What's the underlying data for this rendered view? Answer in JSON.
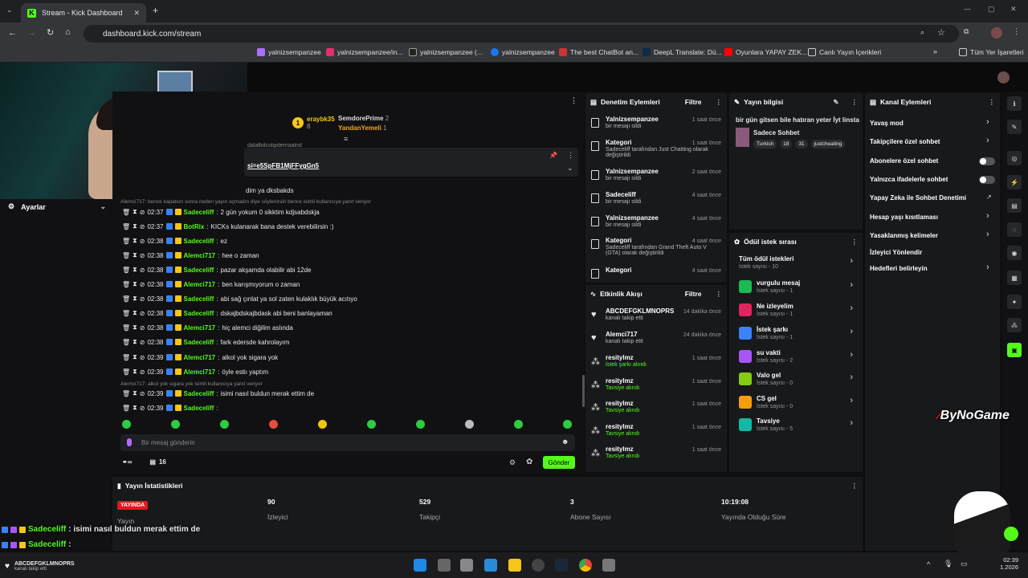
{
  "browser": {
    "tab_title": "Stream - Kick Dashboard",
    "url": "dashboard.kick.com/stream"
  },
  "bookmarks": [
    {
      "label": "yalnizsempanzee",
      "color": "#a970ff"
    },
    {
      "label": "yalnizsempanzee/in...",
      "color": "#e1306c"
    },
    {
      "label": "yalnizsempanzee (...",
      "color": "#111111"
    },
    {
      "label": "yalnizsempanzee",
      "color": "#1877f2"
    },
    {
      "label": "The best ChatBot an...",
      "color": "#cc3333"
    },
    {
      "label": "DeepL Translate: Dü...",
      "color": "#0f2b46"
    },
    {
      "label": "Oyunlara YAPAY ZEK...",
      "color": "#ff0000"
    },
    {
      "label": "Canlı Yayın İçerikleri",
      "color": "#555555"
    }
  ],
  "bookmarks_other": "Tüm Yer İşaretleri",
  "sidebar": {
    "settings_label": "Ayarlar"
  },
  "chat": {
    "pinned_top": [
      {
        "user": "eraybk35",
        "count": "8"
      },
      {
        "user": "SemdorePrime",
        "count": "2"
      },
      {
        "user": "YandanYemeli",
        "count": "1"
      }
    ],
    "pinned_text": "dalalbdcolgidemaalnd",
    "link_text": "si=e5SpFB1MjFFygGn5",
    "line_frag": "dim ya dksbakds",
    "reply_hint_1": "Alemci717: bence kapatsın sonra neden yayın açmadın diye söylenirsin bence isimli kullanıcıya yanıt veriyor",
    "reply_hint_2": "Alemci717: alkol yok sigara yok isimli kullanıcıya yanıt veriyor",
    "messages": [
      {
        "time": "02:37",
        "user": "Sadeceliff",
        "color": "#53fc18",
        "text": "2 gün yokum 0 sikktim kdjsabdskja"
      },
      {
        "time": "02:37",
        "user": "BotRix",
        "color": "#53fc18",
        "text": "KICKs kulanarak bana destek verebilirsin :)"
      },
      {
        "time": "02:38",
        "user": "Sadeceliff",
        "color": "#53fc18",
        "text": "ez"
      },
      {
        "time": "02:38",
        "user": "Alemci717",
        "color": "#53fc18",
        "text": "hee o zaman"
      },
      {
        "time": "02:38",
        "user": "Sadeceliff",
        "color": "#53fc18",
        "text": "pazar akşamda olabilir abi 12de"
      },
      {
        "time": "02:38",
        "user": "Alemci717",
        "color": "#53fc18",
        "text": "ben karışmıyorum o zaman"
      },
      {
        "time": "02:38",
        "user": "Sadeceliff",
        "color": "#53fc18",
        "text": "abi sağ çınlat ya sol zaten kulaklık büyük acıtıyo"
      },
      {
        "time": "02:38",
        "user": "Sadeceliff",
        "color": "#53fc18",
        "text": "dskajbdskajbdask abi beni banlayaman"
      },
      {
        "time": "02:38",
        "user": "Alemci717",
        "color": "#53fc18",
        "text": "hiç alemci diğilim aslında"
      },
      {
        "time": "02:38",
        "user": "Sadeceliff",
        "color": "#53fc18",
        "text": "fark edersde kahrolayım"
      },
      {
        "time": "02:39",
        "user": "Alemci717",
        "color": "#53fc18",
        "text": "alkol yok sigara yok"
      },
      {
        "time": "02:39",
        "user": "Alemci717",
        "color": "#53fc18",
        "text": "öyle estiı yaptım"
      },
      {
        "time": "02:39",
        "user": "Sadeceliff",
        "color": "#53fc18",
        "text": "isimi nasıl buldun merak ettim de"
      },
      {
        "time": "02:39",
        "user": "Sadeceliff",
        "color": "#53fc18",
        "text": ""
      }
    ],
    "input_placeholder": "Bir mesaj gönderin",
    "viewer_count": "16",
    "send_label": "Gönder"
  },
  "mod_actions": {
    "title": "Denetim Eylemleri",
    "filter": "Filtre",
    "items": [
      {
        "title": "Yalnizsempanzee",
        "sub": "bir mesajı sildi",
        "time": "1 saat önce"
      },
      {
        "title": "Kategori",
        "sub": "Sadeceliff tarafından Just Chatting olarak değiştirildi",
        "time": "1 saat önce"
      },
      {
        "title": "Yalnizsempanzee",
        "sub": "bir mesajı sildi",
        "time": "2 saat önce"
      },
      {
        "title": "Sadeceliff",
        "sub": "bir mesajı sildi",
        "time": "4 saat önce"
      },
      {
        "title": "Yalnizsempanzee",
        "sub": "bir mesajı sildi",
        "time": "4 saat önce"
      },
      {
        "title": "Kategori",
        "sub": "Sadeceliff tarafından Grand Theft Auto V (GTA) olarak değiştirildi",
        "time": "4 saat önce"
      },
      {
        "title": "Kategori",
        "sub": "",
        "time": "4 saat önce"
      }
    ]
  },
  "activity": {
    "title": "Etkinlik Akışı",
    "filter": "Filtre",
    "items": [
      {
        "title": "ABCDEFGKLMNOPRS",
        "sub": "kanalı takip etti",
        "time": "14 dakika önce"
      },
      {
        "title": "Alemci717",
        "sub": "kanalı takip etti",
        "time": "24 dakika önce"
      },
      {
        "title": "resitylmz",
        "sub": "İstek şarkı alındı",
        "time": "1 saat önce"
      },
      {
        "title": "resitylmz",
        "sub": "Tavsiye alındı",
        "time": "1 saat önce"
      },
      {
        "title": "resitylmz",
        "sub": "Tavsiye alındı",
        "time": "1 saat önce"
      },
      {
        "title": "resitylmz",
        "sub": "Tavsiye alındı",
        "time": "1 saat önce"
      },
      {
        "title": "resitylmz",
        "sub": "Tavsiye alındı",
        "time": "1 saat önce"
      }
    ]
  },
  "stream_info": {
    "title": "Yayın bilgisi",
    "stream_title": "bir gün gitsen bile hatıran yeter İyt linsta",
    "category": "Sadece Sohbet",
    "tags": [
      "Turkish",
      "18",
      "31",
      "justcheating"
    ]
  },
  "rewards": {
    "title": "Ödül istek sırası",
    "all_label": "Tüm ödül istekleri",
    "all_count": "İstek sayısı - 10",
    "items": [
      {
        "name": "vurgulu mesaj",
        "count": "İstek sayısı - 1",
        "color": "#1db954"
      },
      {
        "name": "Ne izleyelim",
        "count": "İstek sayısı - 1",
        "color": "#e0245e"
      },
      {
        "name": "İstek şarkı",
        "count": "İstek sayısı - 1",
        "color": "#3b82f6"
      },
      {
        "name": "su vakti",
        "count": "İstek sayısı - 2",
        "color": "#a855f7"
      },
      {
        "name": "Valo gel",
        "count": "İstek sayısı - 0",
        "color": "#84cc16"
      },
      {
        "name": "CS gel",
        "count": "İstek sayısı - 0",
        "color": "#f59e0b"
      },
      {
        "name": "Tavsiye",
        "count": "İstek sayısı - 5",
        "color": "#14b8a6"
      }
    ]
  },
  "channel_actions": {
    "title": "Kanal Eylemleri",
    "items": [
      {
        "label": "Yavaş mod",
        "kind": "arrow"
      },
      {
        "label": "Takipçilere özel sohbet",
        "kind": "arrow"
      },
      {
        "label": "Abonelere özel sohbet",
        "kind": "toggle"
      },
      {
        "label": "Yalnızca ifadelerle sohbet",
        "kind": "toggle"
      },
      {
        "label": "Yapay Zeka ile Sohbet Denetimi",
        "kind": "link"
      },
      {
        "label": "Hesap yaşı kısıtlaması",
        "kind": "arrow"
      },
      {
        "label": "Yasaklanmış kelimeler",
        "kind": "arrow"
      },
      {
        "label": "İzleyici Yönlendir",
        "kind": "none"
      },
      {
        "label": "Hedefleri belirleyin",
        "kind": "arrow"
      }
    ]
  },
  "stats": {
    "title": "Yayın İstatistikleri",
    "live_badge": "YAYINDA",
    "items": [
      {
        "value": "",
        "label": "Yayın"
      },
      {
        "value": "90",
        "label": "İzleyici"
      },
      {
        "value": "529",
        "label": "Takipçi"
      },
      {
        "value": "3",
        "label": "Abone Sayısı"
      },
      {
        "value": "10:19:08",
        "label": "Yayında Olduğu Süre"
      }
    ]
  },
  "overlay": {
    "chat1_user": "Sadeceliff",
    "chat1_text": ": isimi nasıl buldun merak ettim de",
    "chat2_user": "Sadeceliff",
    "chat2_text": ":",
    "follow_user": "ABCDEFGKLMNOPRS",
    "follow_text": "kanalı takip etti",
    "brand": "ByNoGame"
  },
  "taskbar": {
    "time": "02:39",
    "date": "1.2026"
  }
}
